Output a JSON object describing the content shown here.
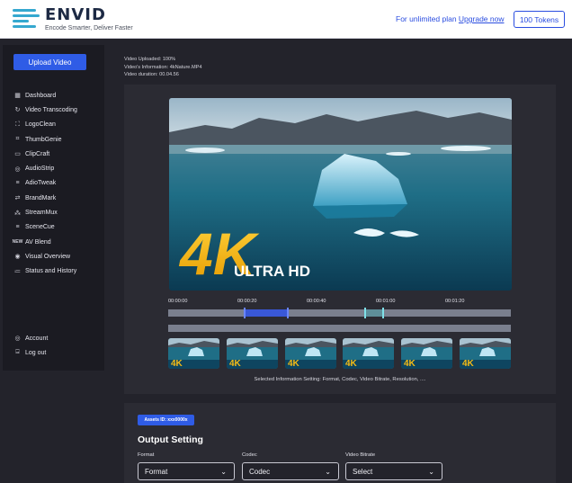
{
  "header": {
    "logo_name": "ENVID",
    "logo_tagline": "Encode Smarter, Deliver Faster",
    "upgrade_prefix": "For unlimited plan ",
    "upgrade_link": "Upgrade now",
    "tokens_label": "100 Tokens",
    "brand_color": "#35a8cf",
    "accent_color": "#2f5ce6"
  },
  "sidebar": {
    "upload_label": "Upload Video",
    "items": [
      {
        "label": "Dashboard",
        "icon": "grid-icon"
      },
      {
        "label": "Video Transcoding",
        "icon": "refresh-icon"
      },
      {
        "label": "LogoClean",
        "icon": "crop-icon"
      },
      {
        "label": "ThumbGenie",
        "icon": "scan-icon"
      },
      {
        "label": "ClipCraft",
        "icon": "monitor-icon"
      },
      {
        "label": "AudioStrip",
        "icon": "audio-icon"
      },
      {
        "label": "AdioTweak",
        "icon": "sliders-icon"
      },
      {
        "label": "BrandMark",
        "icon": "brand-icon"
      },
      {
        "label": "StreamMux",
        "icon": "stream-icon"
      },
      {
        "label": "SceneCue",
        "icon": "scene-icon"
      },
      {
        "label": "AV Blend",
        "icon": "blend-icon"
      },
      {
        "label": "Visual Overview",
        "icon": "eye-icon"
      },
      {
        "label": "Status and History",
        "icon": "history-icon"
      }
    ],
    "bottom": [
      {
        "label": "Account",
        "icon": "account-icon"
      },
      {
        "label": "Log out",
        "icon": "logout-icon"
      }
    ]
  },
  "info": {
    "uploaded": "Video Uploaded: 100%",
    "information": "Video's Information: 4kNature.MP4",
    "duration": "Video duration: 00.04.56"
  },
  "video": {
    "overlay_big": "4K",
    "overlay_small": "ULTRA HD"
  },
  "timeline": {
    "labels": [
      "00:00:00",
      "00:00:20",
      "00:00:40",
      "00:01:00",
      "00:01:20"
    ]
  },
  "panel_note": "Selected Information Setting: Format, Codec, Video Bitrate, Resolution, ....",
  "output": {
    "asset_badge": "Assets ID: xxx0000x",
    "title": "Output Setting",
    "fields": [
      {
        "label": "Format",
        "value": "Format"
      },
      {
        "label": "Codec",
        "value": "Codec"
      },
      {
        "label": "Video Bitrate",
        "value": "Select"
      }
    ]
  }
}
